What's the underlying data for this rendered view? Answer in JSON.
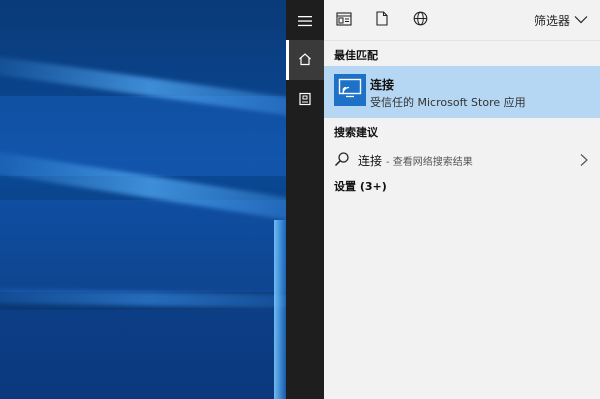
{
  "toolbar": {
    "filter_label": "筛选器"
  },
  "best_match": {
    "section_title": "最佳匹配",
    "app_name": "连接",
    "app_subtitle": "受信任的 Microsoft Store 应用"
  },
  "suggestions": {
    "section_title": "搜索建议",
    "item_main": "连接",
    "item_sub": "- 查看网络搜索结果"
  },
  "settings": {
    "label": "设置 (3+)"
  },
  "icons": {
    "menu": "hamburger-icon",
    "home": "home-icon",
    "document": "document-icon",
    "apps": "apps-icon",
    "file": "file-icon",
    "web": "globe-icon",
    "chevron": "chevron-down-icon",
    "search": "search-icon",
    "arrow": "chevron-right-icon",
    "connect_app": "connect-cast-icon"
  },
  "colors": {
    "selection": "#b6d7f3",
    "app_tile": "#1d72c8",
    "rail": "#1e1e1e"
  }
}
